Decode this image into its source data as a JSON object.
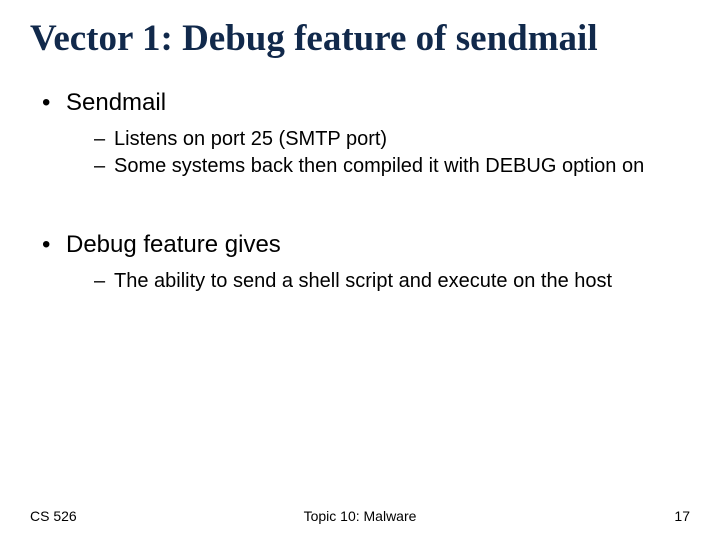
{
  "title": "Vector 1: Debug feature of sendmail",
  "bullets": [
    {
      "text": "Sendmail",
      "sub": [
        "Listens on port 25 (SMTP port)",
        "Some systems back then compiled it with DEBUG option on"
      ]
    },
    {
      "text": "Debug feature gives",
      "sub": [
        "The ability to send a shell script and execute on the host"
      ]
    }
  ],
  "footer": {
    "left": "CS 526",
    "center": "Topic 10: Malware",
    "right": "17"
  }
}
